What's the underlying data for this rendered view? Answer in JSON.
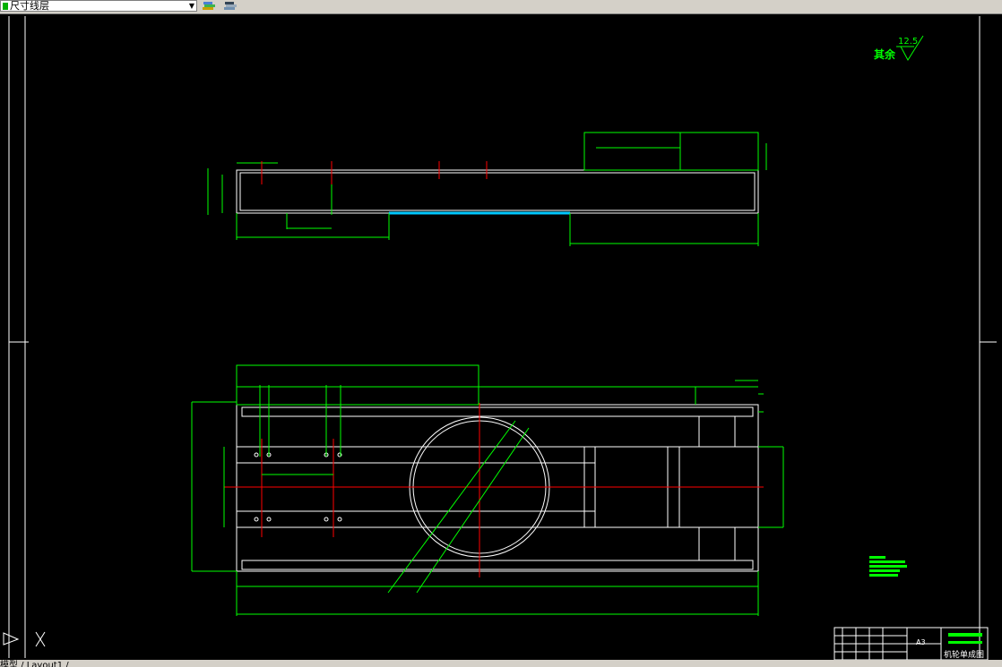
{
  "toolbar": {
    "layer_name": "尺寸线层",
    "layer_color": "#00b000",
    "dropdown_icon": "chevron-down-icon",
    "layer_manager_icon": "layer-properties-icon",
    "layer_state_icon": "layer-states-icon"
  },
  "drawing": {
    "surface_note": "其余",
    "roughness_value": "12.5",
    "sheet_size": "A3",
    "drawing_name": "机轮单成图"
  },
  "tabs": {
    "text": "模型 / Layout1 /"
  },
  "ucs_icon": "ucs-icon",
  "colors": {
    "background": "#000000",
    "geometry": "#ffffff",
    "dimension": "#00ff00",
    "centerline": "#ff0000",
    "highlight": "#00c8ff"
  }
}
